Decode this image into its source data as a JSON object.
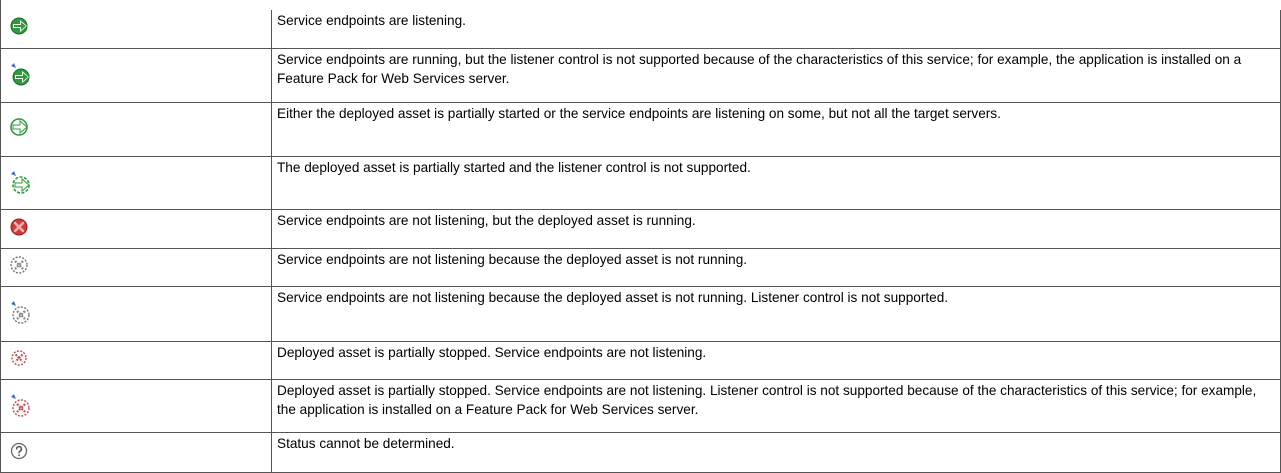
{
  "rows": [
    {
      "icon": "green-arrow-icon",
      "text": "Service endpoints are listening."
    },
    {
      "icon": "green-arrow-listener-unsupported-icon",
      "text": "Service endpoints are running, but the listener control is not supported because of the characteristics of this service; for example, the application is installed on a Feature Pack for Web Services server."
    },
    {
      "icon": "partial-arrow-icon",
      "text": "Either the deployed asset is partially started or the service endpoints are listening on some, but not all the target servers."
    },
    {
      "icon": "partial-arrow-listener-unsupported-icon",
      "text": "The deployed asset is partially started and the listener control is not supported."
    },
    {
      "icon": "red-x-icon",
      "text": "Service endpoints are not listening, but the deployed asset is running."
    },
    {
      "icon": "gray-x-icon",
      "text": "Service endpoints are not listening because the deployed asset is not running."
    },
    {
      "icon": "gray-x-listener-unsupported-icon",
      "text": "Service endpoints are not listening because the deployed asset is not running. Listener control is not supported."
    },
    {
      "icon": "partial-stop-icon",
      "text": "Deployed asset is partially stopped. Service endpoints are not listening."
    },
    {
      "icon": "partial-stop-listener-unsupported-icon",
      "text": "Deployed asset is partially stopped. Service endpoints are not listening. Listener control is not supported because of the characteristics of this service; for example, the application is installed on a Feature Pack for Web Services server."
    },
    {
      "icon": "question-icon",
      "text": "Status cannot be determined."
    }
  ]
}
